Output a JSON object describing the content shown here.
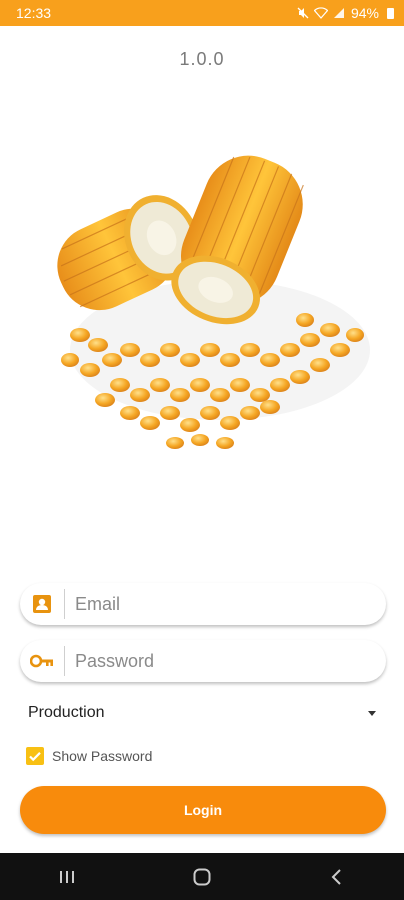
{
  "status_bar": {
    "time": "12:33",
    "battery": "94%",
    "icons": [
      "mute-icon",
      "wifi-icon",
      "signal-icon",
      "battery-icon"
    ]
  },
  "app": {
    "version": "1.0.0"
  },
  "login_form": {
    "email_placeholder": "Email",
    "email_value": "",
    "password_placeholder": "Password",
    "password_value": "",
    "environment_selected": "Production",
    "show_password_label": "Show Password",
    "show_password_checked": true,
    "login_label": "Login"
  },
  "colors": {
    "accent": "#F8A01C",
    "button": "#F88B0C",
    "checkbox": "#F8C013",
    "nav_bar": "#111111"
  },
  "nav_bar": {
    "buttons": [
      "recents-icon",
      "home-icon",
      "back-icon"
    ]
  }
}
